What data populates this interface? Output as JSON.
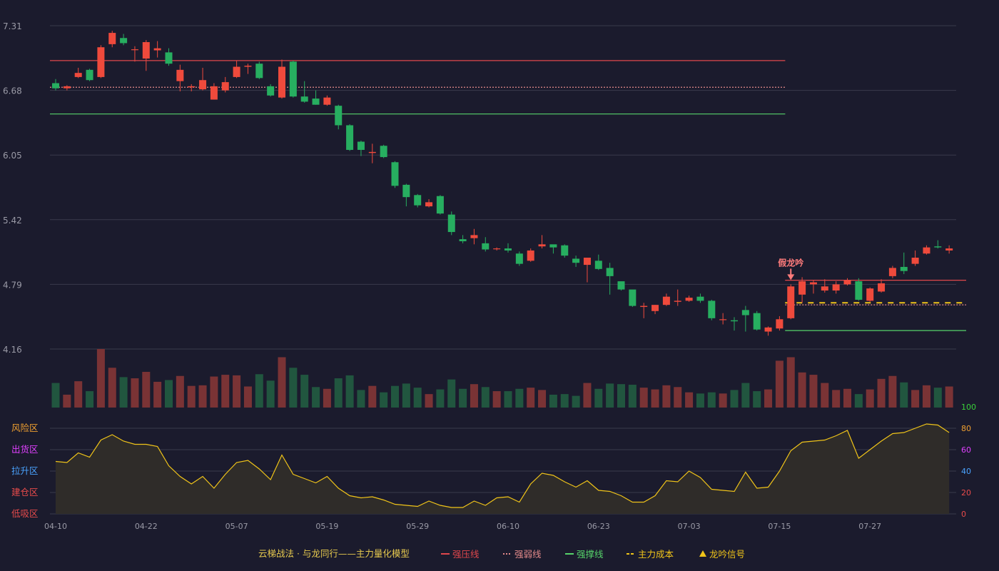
{
  "colors": {
    "background": "#1b1b2d",
    "up": "#ef4a3c",
    "down": "#27ae60",
    "volume_up": "#7a3335",
    "volume_down": "#21563f",
    "grid": "#3a3b4c",
    "tick_text": "#9a9aa6",
    "resistance_line": "#e0474c",
    "weak_line": "#e38a8a",
    "support_line": "#56d36a",
    "cost_line": "#f0c419",
    "indicator_line": "#f0c419",
    "indicator_fill": "#2f2c29",
    "signal_label": "#ff7b7b"
  },
  "legend": {
    "title": "云梯战法 · 与龙同行——主力量化模型",
    "items": [
      {
        "label": "强压线",
        "style": "solid",
        "color": "#e0474c"
      },
      {
        "label": "强弱线",
        "style": "dotted",
        "color": "#e38a8a"
      },
      {
        "label": "强撑线",
        "style": "solid",
        "color": "#56d36a"
      },
      {
        "label": "主力成本",
        "style": "dashed",
        "color": "#f0c419"
      },
      {
        "label": "龙吟信号",
        "style": "triangle",
        "color": "#f0c419"
      }
    ]
  },
  "chart_data": {
    "type": "candlestick",
    "x_tick_labels": [
      "04-10",
      "04-22",
      "05-07",
      "05-19",
      "05-29",
      "06-10",
      "06-23",
      "07-03",
      "07-15",
      "07-27"
    ],
    "x_tick_indices": [
      0,
      8,
      16,
      24,
      32,
      40,
      48,
      56,
      64,
      72
    ],
    "price_axis": {
      "ylim": [
        4.16,
        7.31
      ],
      "ticks": [
        7.31,
        6.68,
        6.05,
        5.42,
        4.79,
        4.16
      ],
      "grid": true
    },
    "candles": [
      [
        6.75,
        6.7,
        6.79,
        6.68
      ],
      [
        6.7,
        6.72,
        6.73,
        6.68
      ],
      [
        6.81,
        6.85,
        6.9,
        6.8
      ],
      [
        6.88,
        6.78,
        6.89,
        6.77
      ],
      [
        6.81,
        7.1,
        7.12,
        6.8
      ],
      [
        7.13,
        7.24,
        7.26,
        7.1
      ],
      [
        7.19,
        7.14,
        7.23,
        7.12
      ],
      [
        7.08,
        7.08,
        7.11,
        6.96
      ],
      [
        6.99,
        7.15,
        7.17,
        6.87
      ],
      [
        7.07,
        7.09,
        7.16,
        7.0
      ],
      [
        7.05,
        6.94,
        7.09,
        6.92
      ],
      [
        6.77,
        6.88,
        6.93,
        6.67
      ],
      [
        6.71,
        6.72,
        6.74,
        6.67
      ],
      [
        6.69,
        6.78,
        6.9,
        6.68
      ],
      [
        6.59,
        6.72,
        6.75,
        6.59
      ],
      [
        6.68,
        6.76,
        6.81,
        6.66
      ],
      [
        6.81,
        6.91,
        6.97,
        6.8
      ],
      [
        6.91,
        6.92,
        6.94,
        6.84
      ],
      [
        6.94,
        6.8,
        6.96,
        6.79
      ],
      [
        6.72,
        6.63,
        6.74,
        6.62
      ],
      [
        6.61,
        6.91,
        6.98,
        6.6
      ],
      [
        6.96,
        6.62,
        6.97,
        6.61
      ],
      [
        6.62,
        6.57,
        6.77,
        6.56
      ],
      [
        6.6,
        6.54,
        6.68,
        6.54
      ],
      [
        6.54,
        6.61,
        6.63,
        6.53
      ],
      [
        6.53,
        6.34,
        6.54,
        6.3
      ],
      [
        6.34,
        6.1,
        6.35,
        6.09
      ],
      [
        6.18,
        6.1,
        6.19,
        6.04
      ],
      [
        6.07,
        6.08,
        6.16,
        5.97
      ],
      [
        6.14,
        6.03,
        6.15,
        6.02
      ],
      [
        5.98,
        5.75,
        5.99,
        5.73
      ],
      [
        5.76,
        5.64,
        5.77,
        5.55
      ],
      [
        5.66,
        5.56,
        5.67,
        5.54
      ],
      [
        5.55,
        5.59,
        5.62,
        5.54
      ],
      [
        5.65,
        5.48,
        5.66,
        5.47
      ],
      [
        5.47,
        5.3,
        5.5,
        5.27
      ],
      [
        5.23,
        5.21,
        5.27,
        5.19
      ],
      [
        5.24,
        5.27,
        5.33,
        5.18
      ],
      [
        5.19,
        5.13,
        5.25,
        5.11
      ],
      [
        5.14,
        5.14,
        5.15,
        5.12
      ],
      [
        5.14,
        5.12,
        5.19,
        5.1
      ],
      [
        5.09,
        4.99,
        5.11,
        4.97
      ],
      [
        5.02,
        5.12,
        5.14,
        5.01
      ],
      [
        5.16,
        5.18,
        5.27,
        5.14
      ],
      [
        5.18,
        5.15,
        5.17,
        5.09
      ],
      [
        5.17,
        5.07,
        5.18,
        5.05
      ],
      [
        5.04,
        5.0,
        5.07,
        4.96
      ],
      [
        4.98,
        5.05,
        5.05,
        4.81
      ],
      [
        5.02,
        4.94,
        5.08,
        4.93
      ],
      [
        4.95,
        4.87,
        5.0,
        4.69
      ],
      [
        4.82,
        4.74,
        4.81,
        4.73
      ],
      [
        4.74,
        4.58,
        4.73,
        4.57
      ],
      [
        4.57,
        4.58,
        4.61,
        4.46
      ],
      [
        4.53,
        4.59,
        4.59,
        4.5
      ],
      [
        4.59,
        4.67,
        4.7,
        4.58
      ],
      [
        4.62,
        4.63,
        4.74,
        4.58
      ],
      [
        4.63,
        4.66,
        4.68,
        4.62
      ],
      [
        4.67,
        4.63,
        4.7,
        4.61
      ],
      [
        4.63,
        4.46,
        4.64,
        4.44
      ],
      [
        4.45,
        4.45,
        4.51,
        4.4
      ],
      [
        4.44,
        4.43,
        4.47,
        4.34
      ],
      [
        4.54,
        4.49,
        4.58,
        4.33
      ],
      [
        4.51,
        4.35,
        4.53,
        4.34
      ],
      [
        4.33,
        4.37,
        4.38,
        4.29
      ],
      [
        4.36,
        4.45,
        4.48,
        4.34
      ],
      [
        4.46,
        4.77,
        4.79,
        4.45
      ],
      [
        4.69,
        4.82,
        4.86,
        4.61
      ],
      [
        4.79,
        4.81,
        4.83,
        4.7
      ],
      [
        4.73,
        4.77,
        4.84,
        4.71
      ],
      [
        4.73,
        4.79,
        4.82,
        4.7
      ],
      [
        4.79,
        4.83,
        4.85,
        4.78
      ],
      [
        4.82,
        4.64,
        4.85,
        4.63
      ],
      [
        4.63,
        4.75,
        4.76,
        4.62
      ],
      [
        4.72,
        4.8,
        4.84,
        4.71
      ],
      [
        4.87,
        4.95,
        4.97,
        4.85
      ],
      [
        4.96,
        4.92,
        5.1,
        4.89
      ],
      [
        4.99,
        5.05,
        5.12,
        4.97
      ],
      [
        5.09,
        5.15,
        5.17,
        5.08
      ],
      [
        5.16,
        5.15,
        5.22,
        5.14
      ],
      [
        5.12,
        5.14,
        5.17,
        5.09
      ]
    ],
    "volume": [
      42,
      22,
      45,
      28,
      100,
      68,
      52,
      50,
      61,
      44,
      47,
      54,
      37,
      38,
      53,
      56,
      55,
      36,
      57,
      46,
      86,
      68,
      56,
      35,
      32,
      50,
      55,
      30,
      37,
      26,
      37,
      41,
      34,
      23,
      31,
      48,
      32,
      40,
      35,
      28,
      28,
      32,
      34,
      30,
      22,
      23,
      20,
      42,
      32,
      41,
      40,
      39,
      34,
      31,
      38,
      35,
      26,
      24,
      26,
      24,
      30,
      42,
      28,
      31,
      80,
      86,
      60,
      56,
      42,
      30,
      32,
      23,
      31,
      49,
      54,
      43,
      30,
      38,
      34,
      36
    ],
    "levels": {
      "strong_pressure_1": {
        "value": 6.97,
        "from_index": 0,
        "to_index": 64
      },
      "weak_1": {
        "value": 6.71,
        "from_index": 0,
        "to_index": 64
      },
      "support_1": {
        "value": 6.45,
        "from_index": 0,
        "to_index": 64
      },
      "strong_pressure_2": {
        "value": 4.83,
        "from_index": 65,
        "to_index": 80
      },
      "weak_2": {
        "value": 4.59,
        "from_index": 65,
        "to_index": 80
      },
      "cost_2": {
        "value": 4.61,
        "from_index": 65,
        "to_index": 80
      },
      "support_2": {
        "value": 4.34,
        "from_index": 65,
        "to_index": 80
      }
    },
    "signal": {
      "label": "假龙吟",
      "index": 65
    },
    "indicator": {
      "ylim": [
        0,
        100
      ],
      "ticks": [
        0,
        20,
        40,
        60,
        80,
        100
      ],
      "tick_colors": [
        "#e84b4b",
        "#e84b4b",
        "#4aa3ff",
        "#e040ff",
        "#f0a030",
        "#3ad13a"
      ],
      "zone_labels": [
        {
          "label": "风险区",
          "level": 80,
          "color": "#f0a030"
        },
        {
          "label": "出货区",
          "level": 60,
          "color": "#e040ff"
        },
        {
          "label": "拉升区",
          "level": 40,
          "color": "#4aa3ff"
        },
        {
          "label": "建仓区",
          "level": 20,
          "color": "#e84b4b"
        },
        {
          "label": "低吸区",
          "level": 0,
          "color": "#e84b4b"
        }
      ],
      "values": [
        49,
        48,
        57,
        53,
        69,
        74,
        68,
        65,
        65,
        63,
        45,
        35,
        28,
        35,
        24,
        37,
        48,
        50,
        42,
        32,
        55,
        37,
        33,
        29,
        35,
        24,
        17,
        15,
        16,
        13,
        9,
        8,
        7,
        12,
        8,
        6,
        6,
        12,
        8,
        15,
        16,
        11,
        28,
        38,
        36,
        30,
        25,
        31,
        22,
        21,
        17,
        11,
        11,
        17,
        31,
        30,
        40,
        34,
        23,
        22,
        21,
        39,
        24,
        25,
        40,
        59,
        67,
        68,
        69,
        73,
        78,
        52,
        60,
        68,
        75,
        76,
        80,
        84,
        83,
        76
      ]
    }
  }
}
